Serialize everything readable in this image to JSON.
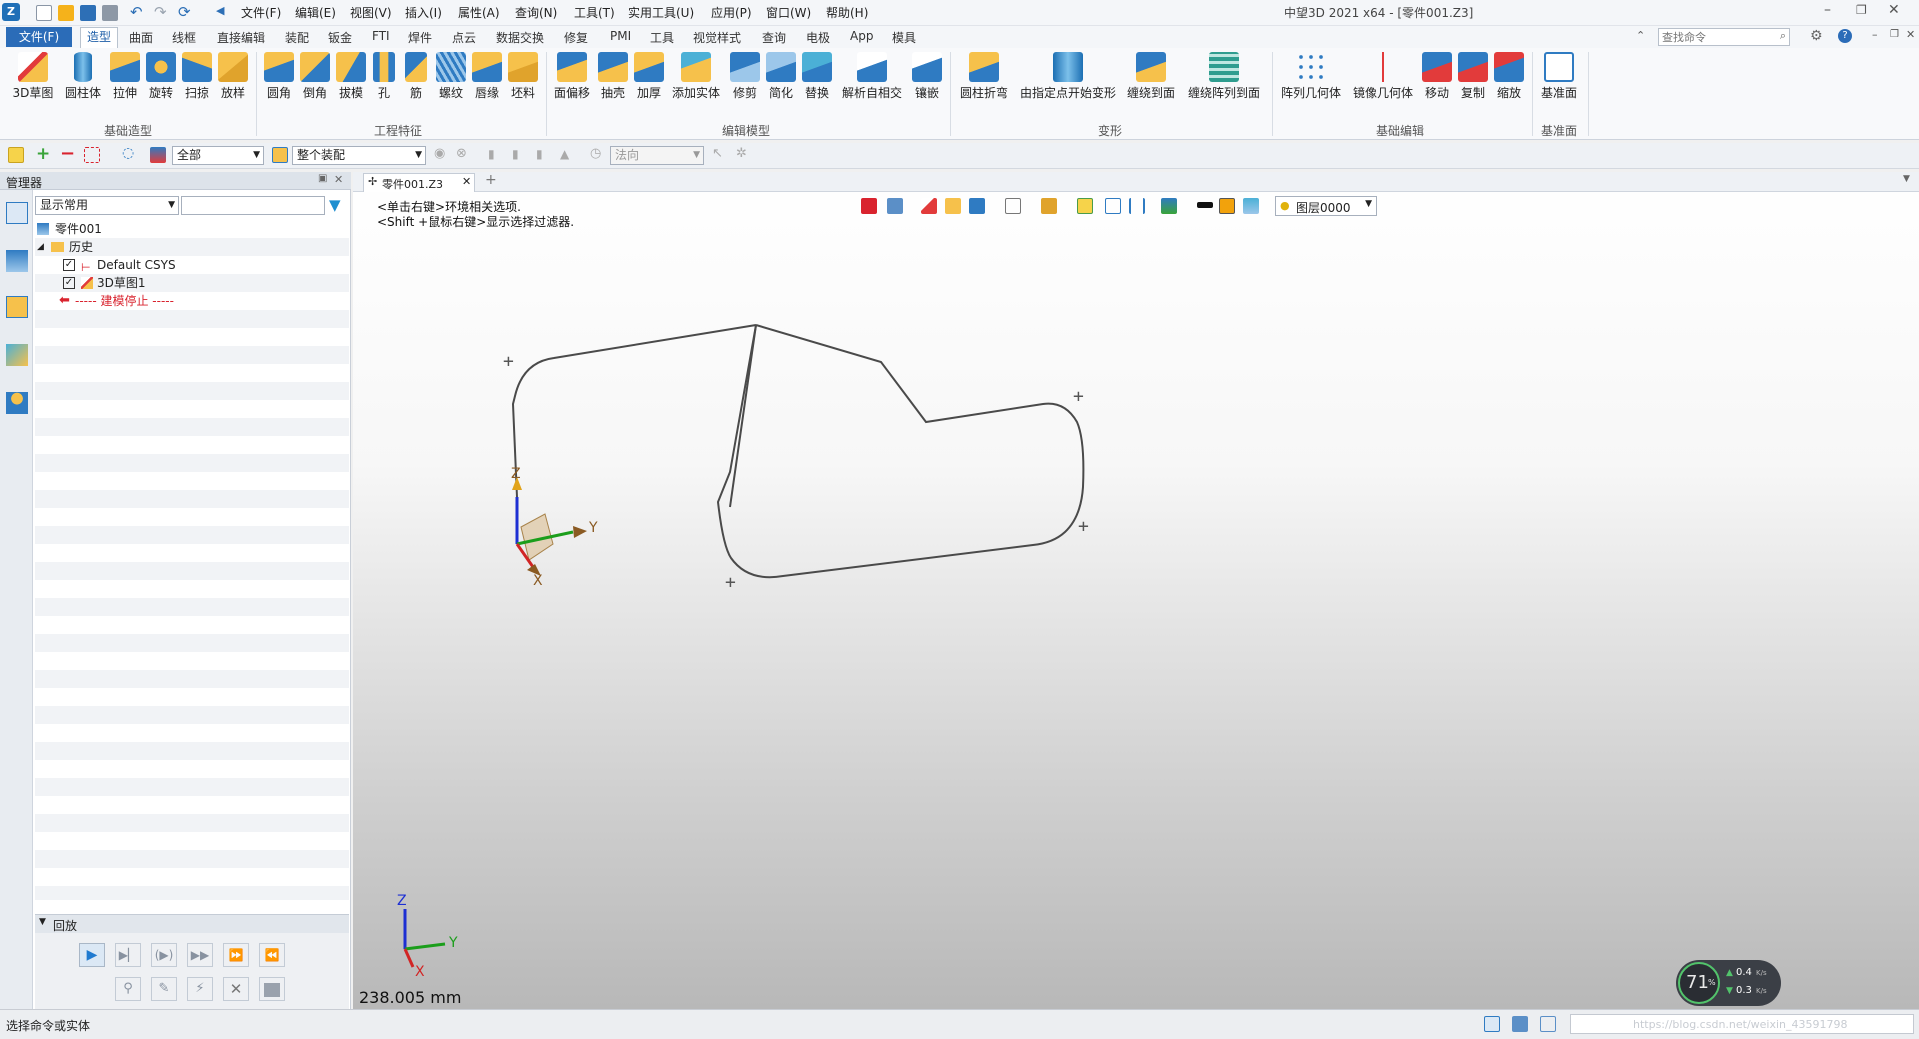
{
  "title_bar": {
    "title": "中望3D 2021 x64 - [零件001.Z3]",
    "quick_menus": [
      "文件(F)",
      "编辑(E)",
      "视图(V)",
      "插入(I)",
      "属性(A)",
      "查询(N)",
      "工具(T)",
      "实用工具(U)",
      "应用(P)",
      "窗口(W)",
      "帮助(H)"
    ],
    "search_placeholder": "查找命令"
  },
  "ribbon_tabs": {
    "file_tab": "文件(F)",
    "tabs": [
      "造型",
      "曲面",
      "线框",
      "直接编辑",
      "装配",
      "钣金",
      "FTI",
      "焊件",
      "点云",
      "数据交换",
      "修复",
      "PMI",
      "工具",
      "视觉样式",
      "查询",
      "电极",
      "App",
      "模具"
    ],
    "active": "造型"
  },
  "ribbon": {
    "buttons": [
      "3D草图",
      "圆柱体",
      "拉伸",
      "旋转",
      "扫掠",
      "放样",
      "圆角",
      "倒角",
      "拔模",
      "孔",
      "筋",
      "螺纹",
      "唇缘",
      "坯料",
      "面偏移",
      "抽壳",
      "加厚",
      "添加实体",
      "修剪",
      "简化",
      "替换",
      "解析自相交",
      "镶嵌",
      "圆柱折弯",
      "由指定点开始变形",
      "缠绕到面",
      "缠绕阵列到面",
      "阵列几何体",
      "镜像几何体",
      "移动",
      "复制",
      "缩放",
      "基准面"
    ],
    "groups": [
      "基础造型",
      "工程特征",
      "编辑模型",
      "变形",
      "基础编辑",
      "基准面"
    ]
  },
  "filter_bar": {
    "filter_value": "全部",
    "scope_value": "整个装配",
    "direction_value": "法向"
  },
  "manager": {
    "title": "管理器",
    "display_select": "显示常用",
    "tree": [
      {
        "label": "零件001"
      },
      {
        "label": "历史"
      },
      {
        "label": "Default CSYS"
      },
      {
        "label": "3D草图1"
      },
      {
        "label": "----- 建模停止 -----"
      }
    ],
    "playback": {
      "title": "回放"
    }
  },
  "viewport": {
    "doc_tab": "零件001.Z3",
    "hints": [
      "<单击右键>环境相关选项.",
      "<Shift +鼠标右键>显示选择过滤器."
    ],
    "layer": "图层0000",
    "measure": "238.005 mm",
    "axis_labels": {
      "x": "X",
      "y": "Y",
      "z": "Z"
    }
  },
  "status": {
    "prompt": "选择命令或实体",
    "perf_percent": "71",
    "perf_unit": "%",
    "up_rate": "0.4",
    "down_rate": "0.3",
    "rate_unit": "K/s",
    "watermark": "https://blog.csdn.net/weixin_43591798"
  },
  "colors": {
    "accent": "#2b6cb8",
    "sketch_line": "#4a4a4a",
    "stop_line": "#d9232e"
  }
}
